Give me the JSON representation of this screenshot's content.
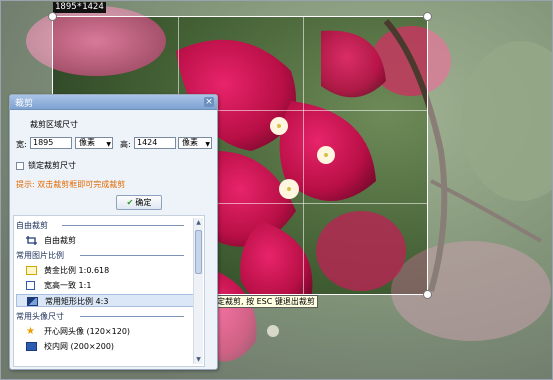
{
  "size_tag": "1895*1424",
  "hint_tooltip": "双击选择的区域确定裁剪, 按 ESC 键退出裁剪",
  "dialog": {
    "title": "裁剪",
    "close": "×",
    "section_label": "裁剪区域尺寸",
    "width_label": "宽:",
    "width_value": "1895",
    "width_unit": "像素",
    "height_label": "高:",
    "height_value": "1424",
    "height_unit": "像素",
    "lock_label": "锁定裁剪尺寸",
    "tip": "提示: 双击裁剪框即可完成裁剪",
    "ok_label": "确定"
  },
  "list": {
    "groups": [
      {
        "title": "自由裁剪",
        "items": [
          {
            "label": "自由裁剪",
            "icon": "crop-icon"
          }
        ]
      },
      {
        "title": "常用图片比例",
        "items": [
          {
            "label": "黄金比例  1:0.618",
            "icon": "golden-ratio-icon"
          },
          {
            "label": "宽高一致  1:1",
            "icon": "square-icon"
          },
          {
            "label": "常用矩形比例  4:3",
            "icon": "rectangle-ratio-icon",
            "selected": true
          }
        ]
      },
      {
        "title": "常用头像尺寸",
        "items": [
          {
            "label": "开心网头像 (120×120)",
            "icon": "kaixin-avatar-icon"
          },
          {
            "label": "校内网 (200×200)",
            "icon": "xiaonei-avatar-icon"
          }
        ]
      }
    ]
  },
  "colors": {
    "accent_tip": "#e06a00",
    "dialog_bg": "#eef3fa",
    "title_bar": "#7ea2d2",
    "selected_row": "#dbe7f7"
  }
}
